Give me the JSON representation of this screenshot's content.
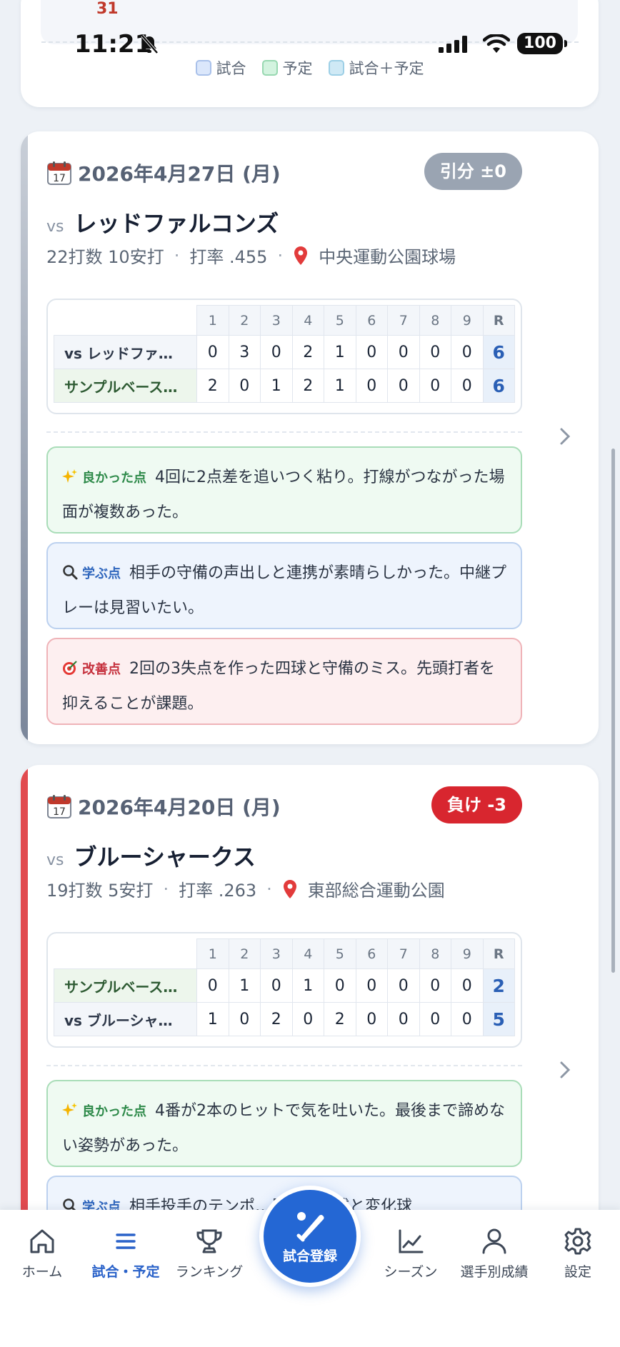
{
  "status": {
    "time": "11:21",
    "battery": "100"
  },
  "calendar": {
    "last_day": "31",
    "legend": [
      {
        "label": "試合",
        "color": "#dbe7fb"
      },
      {
        "label": "予定",
        "color": "#d3f3df"
      },
      {
        "label": "試合＋予定",
        "color": "#cfe9f5"
      }
    ]
  },
  "innings": [
    "1",
    "2",
    "3",
    "4",
    "5",
    "6",
    "7",
    "8",
    "9",
    "R"
  ],
  "games": [
    {
      "date": "2026年4月27日 (月)",
      "result": "引分 ±0",
      "result_color": "#9aa4b2",
      "bar_color": "#8e98a8",
      "vs": "vs",
      "opponent": "レッドファルコンズ",
      "at_bats": "22打数 10安打",
      "avg": "打率 .455",
      "venue": "中央運動公園球場",
      "lines": [
        {
          "team": "vs レッドファ…",
          "own": false,
          "scores": [
            "0",
            "3",
            "0",
            "2",
            "1",
            "0",
            "0",
            "0",
            "0"
          ],
          "r": "6"
        },
        {
          "team": "サンプルベース…",
          "own": true,
          "scores": [
            "2",
            "0",
            "1",
            "2",
            "1",
            "0",
            "0",
            "0",
            "0"
          ],
          "r": "6"
        }
      ],
      "notes": [
        {
          "type": "good",
          "tag": "良かった点",
          "text": "4回に2点差を追いつく粘り。打線がつながった場面が複数あった。"
        },
        {
          "type": "learn",
          "tag": "学ぶ点",
          "text": "相手の守備の声出しと連携が素晴らしかった。中継プレーは見習いたい。"
        },
        {
          "type": "improve",
          "tag": "改善点",
          "text": "2回の3失点を作った四球と守備のミス。先頭打者を抑えることが課題。"
        }
      ]
    },
    {
      "date": "2026年4月20日 (月)",
      "result": "負け -3",
      "result_color": "#d8262f",
      "bar_color": "#e14a4f",
      "vs": "vs",
      "opponent": "ブルーシャークス",
      "at_bats": "19打数 5安打",
      "avg": "打率 .263",
      "venue": "東部総合運動公園",
      "lines": [
        {
          "team": "サンプルベース…",
          "own": true,
          "scores": [
            "0",
            "1",
            "0",
            "1",
            "0",
            "0",
            "0",
            "0",
            "0"
          ],
          "r": "2"
        },
        {
          "team": "vs ブルーシャ…",
          "own": false,
          "scores": [
            "1",
            "0",
            "2",
            "0",
            "2",
            "0",
            "0",
            "0",
            "0"
          ],
          "r": "5"
        }
      ],
      "notes": [
        {
          "type": "good",
          "tag": "良かった点",
          "text": "4番が2本のヒットで気を吐いた。最後まで諦めない姿勢があった。"
        },
        {
          "type": "learn",
          "tag": "学ぶ点",
          "text": "相手投手のテンポ…見事。直球と変化球"
        }
      ]
    }
  ],
  "nav": {
    "items": [
      {
        "label": "ホーム",
        "icon": "home-icon"
      },
      {
        "label": "試合・予定",
        "icon": "list-icon",
        "active": true
      },
      {
        "label": "ランキング",
        "icon": "trophy-icon"
      },
      {
        "label": "シーズン",
        "icon": "chart-icon"
      },
      {
        "label": "選手別成績",
        "icon": "person-icon"
      },
      {
        "label": "設定",
        "icon": "gear-icon"
      }
    ],
    "fab_label": "試合登録"
  }
}
